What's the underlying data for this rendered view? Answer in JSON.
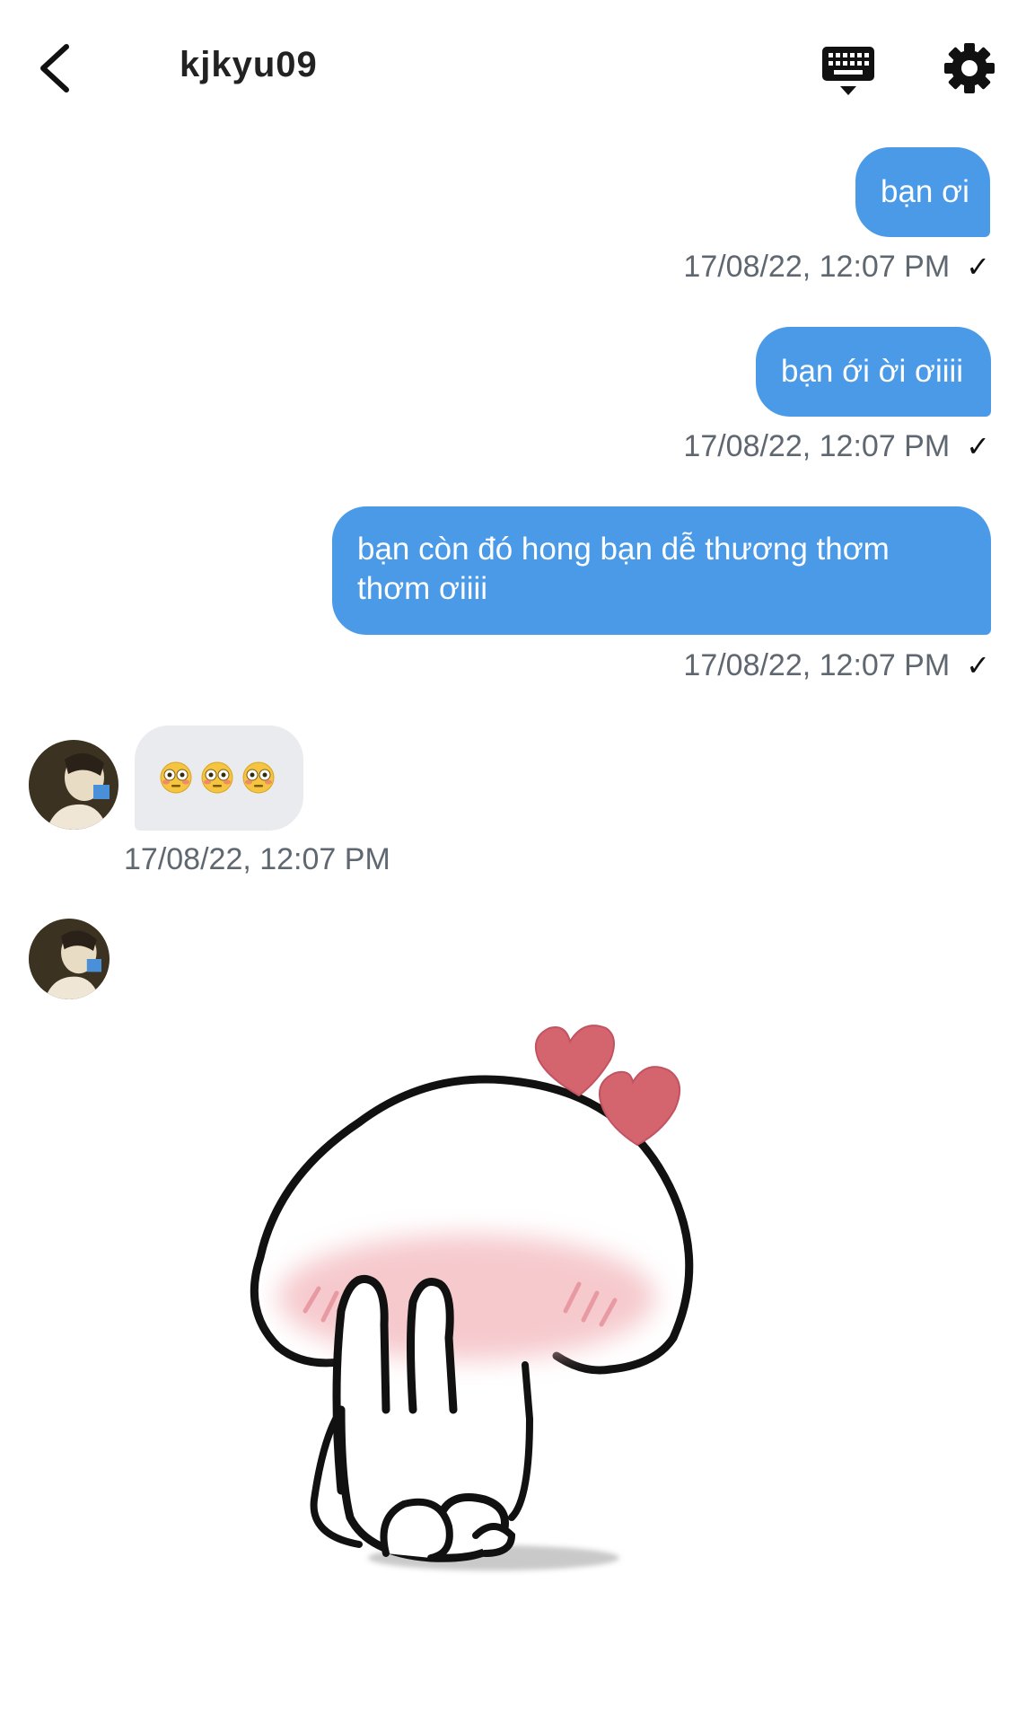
{
  "header": {
    "title": "kjkyu09",
    "back_icon": "chevron-left-icon",
    "keyboard_icon": "keyboard-icon",
    "settings_icon": "gear-icon"
  },
  "messages": [
    {
      "direction": "outgoing",
      "text": "bạn ơi",
      "timestamp": "17/08/22, 12:07 PM",
      "status": "✓"
    },
    {
      "direction": "outgoing",
      "text": "bạn ới ời ơiiii",
      "timestamp": "17/08/22, 12:07 PM",
      "status": "✓"
    },
    {
      "direction": "outgoing",
      "text_line1": "bạn còn đó hong bạn dễ thương thơm",
      "text_line2": "thơm ơiiii",
      "timestamp": "17/08/22, 12:07 PM",
      "status": "✓"
    },
    {
      "direction": "incoming",
      "emojis": [
        "flushed-face-emoji",
        "flushed-face-emoji",
        "flushed-face-emoji"
      ],
      "timestamp": "17/08/22, 12:07 PM"
    },
    {
      "direction": "incoming",
      "sticker": "blushing-bun-with-hearts-sticker"
    }
  ],
  "colors": {
    "outgoing_bubble": "#4a9ae8",
    "incoming_bubble": "#e9ebef",
    "timestamp": "#5f6770",
    "heart": "#d4656f"
  }
}
